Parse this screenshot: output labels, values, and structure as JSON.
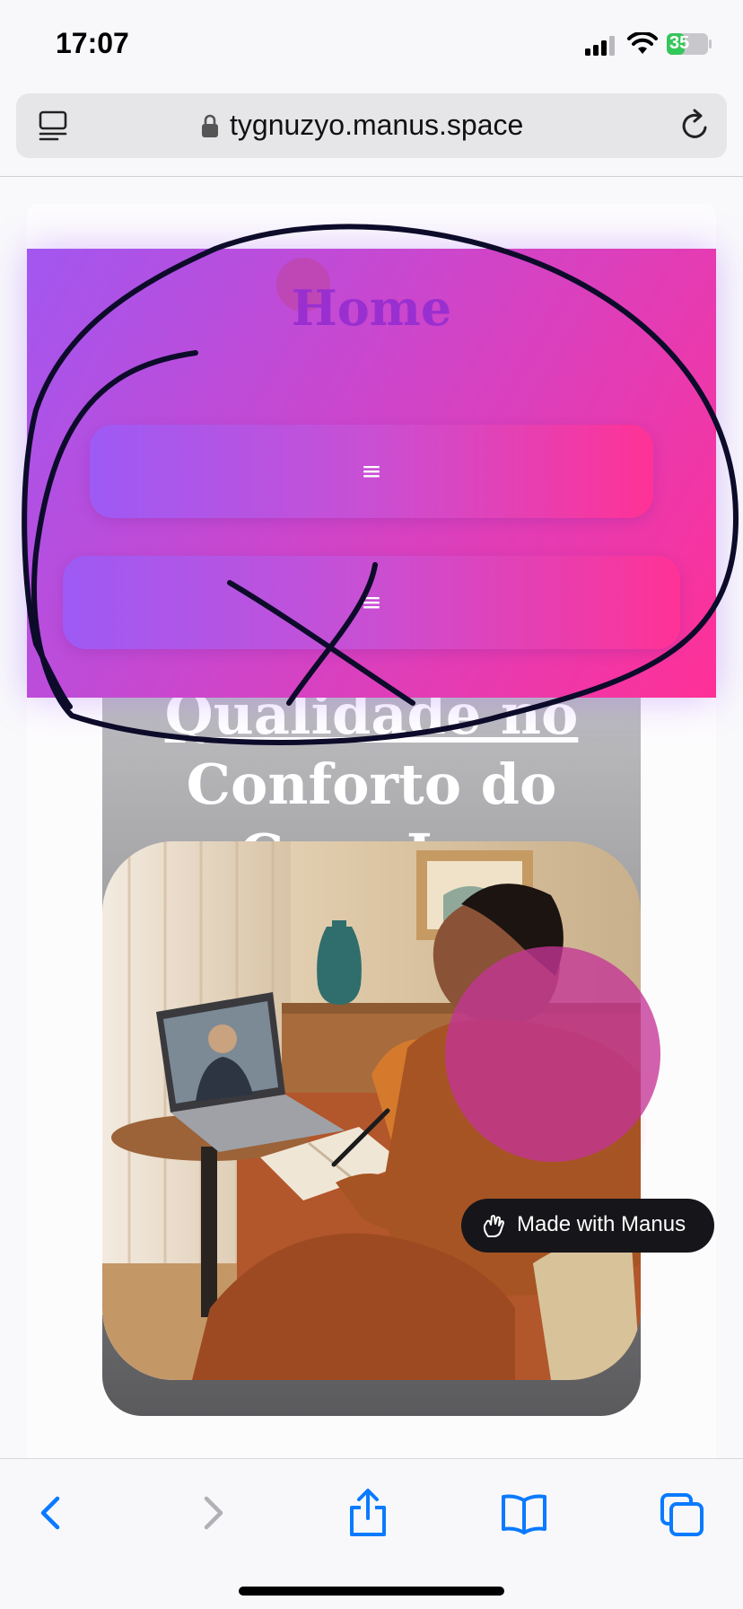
{
  "status_bar": {
    "time": "17:07",
    "battery_level": "35",
    "icons": [
      "signal-icon",
      "wifi-icon",
      "battery-icon"
    ]
  },
  "browser": {
    "url": "tygnuzyo.manus.space",
    "icons": [
      "tabs-icon",
      "lock-icon",
      "reload-icon"
    ]
  },
  "site": {
    "menu": {
      "title": "Home",
      "buttons": [
        {
          "icon": "hamburger-icon",
          "glyph": "≡"
        },
        {
          "icon": "hamburger-icon",
          "glyph": "≡"
        }
      ],
      "gradient_colors": [
        "#a257f0",
        "#cc46cc",
        "#ff3097"
      ]
    },
    "hero": {
      "title_lines": [
        "Qualidade no",
        "Conforto do",
        "Casa L..."
      ]
    },
    "badge": {
      "label": "Made with Manus"
    }
  },
  "toolbar": {
    "buttons": [
      "back-icon",
      "forward-icon",
      "share-icon",
      "bookmarks-icon",
      "tabs-overview-icon"
    ],
    "accent_color": "#0a7aff",
    "disabled_color": "#b0b0b6"
  }
}
